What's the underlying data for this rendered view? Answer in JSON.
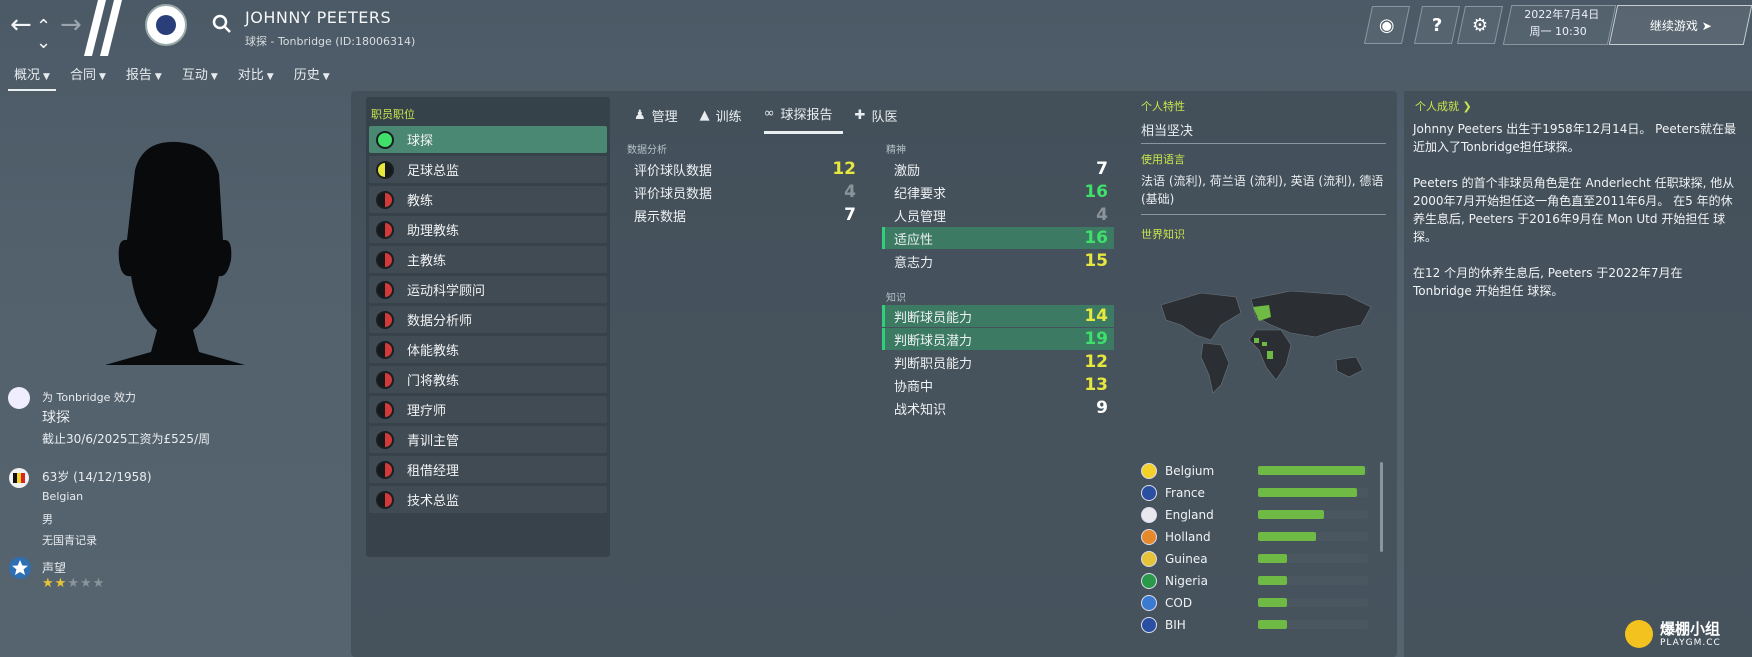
{
  "topbar": {
    "person_name": "JOHNNY PEETERS",
    "subtitle": "球探 - Tonbridge (ID:18006314)",
    "date_line1": "2022年7月4日",
    "date_line2": "周一 10:30",
    "continue_label": "继续游戏",
    "help_icon": "?"
  },
  "menu": [
    {
      "label": "概况"
    },
    {
      "label": "合同"
    },
    {
      "label": "报告"
    },
    {
      "label": "互动"
    },
    {
      "label": "对比"
    },
    {
      "label": "历史"
    }
  ],
  "left": {
    "plays_for": "为 Tonbridge 效力",
    "role": "球探",
    "contract": "截止30/6/2025工资为£525/周",
    "age": "63岁 (14/12/1958)",
    "nationality": "Belgian",
    "gender": "男",
    "youth": "无国青记录",
    "reputation_label": "声望",
    "reputation_stars": 1.5
  },
  "roles": {
    "title": "职员职位",
    "items": [
      {
        "label": "球探",
        "color": "#3fe06a"
      },
      {
        "label": "足球总监",
        "color": "#e6e83e"
      },
      {
        "label": "教练",
        "color": "#d23a3a"
      },
      {
        "label": "助理教练",
        "color": "#d23a3a"
      },
      {
        "label": "主教练",
        "color": "#d23a3a"
      },
      {
        "label": "运动科学顾问",
        "color": "#d23a3a"
      },
      {
        "label": "数据分析师",
        "color": "#d23a3a"
      },
      {
        "label": "体能教练",
        "color": "#d23a3a"
      },
      {
        "label": "门将教练",
        "color": "#d23a3a"
      },
      {
        "label": "理疗师",
        "color": "#d23a3a"
      },
      {
        "label": "青训主管",
        "color": "#d23a3a"
      },
      {
        "label": "租借经理",
        "color": "#d23a3a"
      },
      {
        "label": "技术总监",
        "color": "#d23a3a"
      }
    ]
  },
  "tabs": [
    {
      "label": "管理"
    },
    {
      "label": "训练"
    },
    {
      "label": "球探报告"
    },
    {
      "label": "队医"
    }
  ],
  "data_analysis": {
    "title": "数据分析",
    "items": [
      {
        "label": "评价球队数据",
        "value": "12",
        "color": "yellow"
      },
      {
        "label": "评价球员数据",
        "value": "4",
        "color": "gray"
      },
      {
        "label": "展示数据",
        "value": "7",
        "color": "white"
      }
    ]
  },
  "mental": {
    "title": "精神",
    "items": [
      {
        "label": "激励",
        "value": "7",
        "color": "white",
        "hl": false
      },
      {
        "label": "纪律要求",
        "value": "16",
        "color": "green",
        "hl": false
      },
      {
        "label": "人员管理",
        "value": "4",
        "color": "gray",
        "hl": false
      },
      {
        "label": "适应性",
        "value": "16",
        "color": "green",
        "hl": true
      },
      {
        "label": "意志力",
        "value": "15",
        "color": "yellow",
        "hl": false
      }
    ]
  },
  "knowledge": {
    "title": "知识",
    "items": [
      {
        "label": "判断球员能力",
        "value": "14",
        "color": "yellow",
        "hl": true
      },
      {
        "label": "判断球员潜力",
        "value": "19",
        "color": "green",
        "hl": true
      },
      {
        "label": "判断职员能力",
        "value": "12",
        "color": "yellow",
        "hl": false
      },
      {
        "label": "协商中",
        "value": "13",
        "color": "yellow",
        "hl": false
      },
      {
        "label": "战术知识",
        "value": "9",
        "color": "white",
        "hl": false
      }
    ]
  },
  "traits": {
    "title": "个人特性",
    "value": "相当坚决",
    "lang_title": "使用语言",
    "lang_value": "法语 (流利), 荷兰语 (流利), 英语 (流利), 德语 (基础)",
    "world_title": "世界知识"
  },
  "nations": [
    {
      "name": "Belgium",
      "level": 0.97
    },
    {
      "name": "France",
      "level": 0.9
    },
    {
      "name": "England",
      "level": 0.6
    },
    {
      "name": "Holland",
      "level": 0.53
    },
    {
      "name": "Guinea",
      "level": 0.26
    },
    {
      "name": "Nigeria",
      "level": 0.26
    },
    {
      "name": "COD",
      "level": 0.26
    },
    {
      "name": "BIH",
      "level": 0.26
    }
  ],
  "bio": {
    "title": "个人成就",
    "p1": "Johnny Peeters 出生于1958年12月14日。 Peeters就在最近加入了Tonbridge担任球探。",
    "p2": "Peeters 的首个非球员角色是在 Anderlecht 任职球探, 他从2000年7月开始担任这一角色直至2011年6月。 在5 年的休养生息后, Peeters 于2016年9月在 Mon Utd 开始担任 球探。",
    "p3": "在12 个月的休养生息后, Peeters 于2022年7月在 Tonbridge 开始担任 球探。"
  },
  "watermark": {
    "main": "爆棚小组",
    "sub": "PLAYGM.CC"
  }
}
